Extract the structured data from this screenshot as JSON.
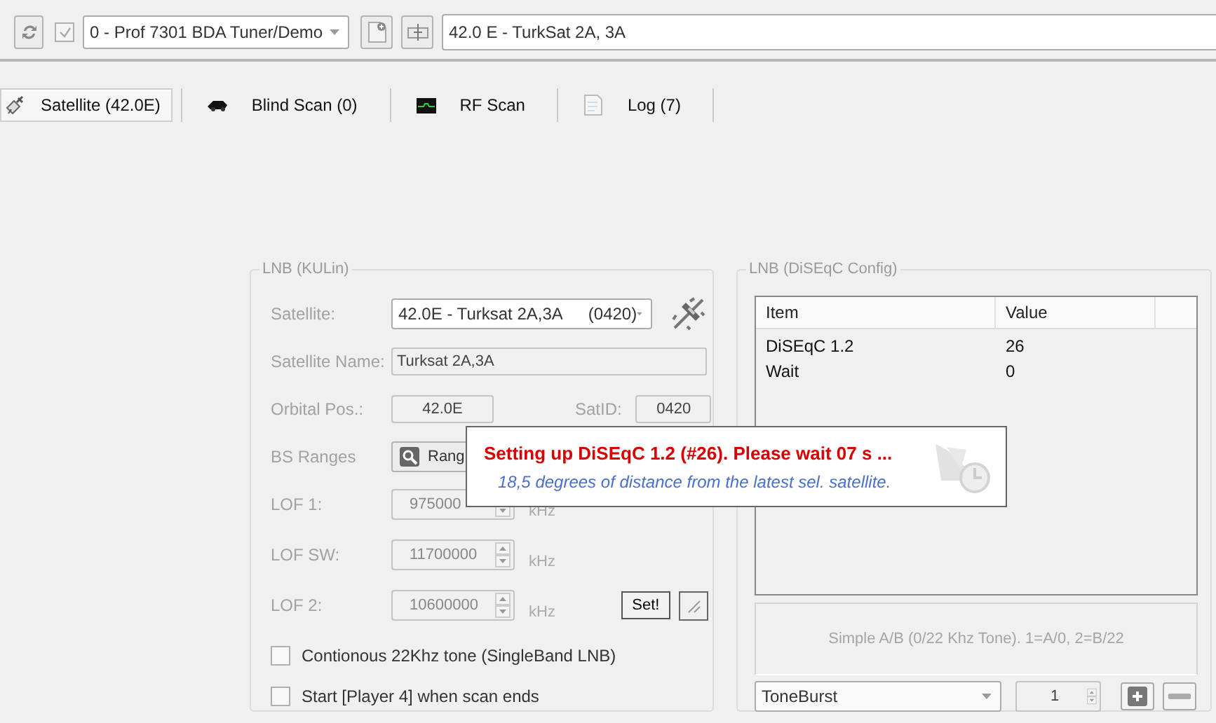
{
  "toolbar": {
    "enabled_checked": true,
    "tuner": "0 - Prof 7301 BDA Tuner/Demo",
    "satellite": "42.0 E - TurkSat 2A, 3A"
  },
  "tabs": [
    {
      "label": "Satellite (42.0E)",
      "selected": true,
      "kind": "satellite"
    },
    {
      "label": "Blind Scan (0)",
      "selected": false,
      "kind": "blind"
    },
    {
      "label": "RF Scan",
      "selected": false,
      "kind": "rf"
    },
    {
      "label": "Log (7)",
      "selected": false,
      "kind": "log"
    }
  ],
  "lnb": {
    "title": "LNB (KULin)",
    "satellite_label": "Satellite:",
    "satellite": "42.0E - Turksat 2A,3A",
    "satellite_code": "(0420)",
    "name_label": "Satellite Name:",
    "name": "Turksat 2A,3A",
    "orbital_label": "Orbital Pos.:",
    "orbital": "42.0E",
    "satid_label": "SatID:",
    "satid": "0420",
    "ranges_label": "BS Ranges",
    "ranges_button": "Rang",
    "lofs": [
      {
        "label": "LOF 1:",
        "value": "975000",
        "unit": "kHz"
      },
      {
        "label": "LOF SW:",
        "value": "11700000",
        "unit": "kHz"
      },
      {
        "label": "LOF 2:",
        "value": "10600000",
        "unit": "kHz"
      }
    ],
    "set_button": "Set!",
    "options": [
      {
        "label": "Contionous 22Khz tone (SingleBand LNB)",
        "checked": false
      },
      {
        "label": "Start [Player 4] when scan ends",
        "checked": false
      }
    ]
  },
  "diseqc": {
    "title": "LNB (DiSEqC Config)",
    "columns": [
      "Item",
      "Value"
    ],
    "rows": [
      {
        "item": "DiSEqC 1.2",
        "value": "26"
      },
      {
        "item": "Wait",
        "value": "0"
      }
    ],
    "info": "Simple A/B (0/22 Khz Tone). 1=A/0, 2=B/22",
    "mode": "ToneBurst",
    "count": "1"
  },
  "toast": {
    "title": "Setting up DiSEqC 1.2 (#26). Please wait 07 s ...",
    "message": "18,5 degrees of distance from the latest sel. satellite."
  }
}
